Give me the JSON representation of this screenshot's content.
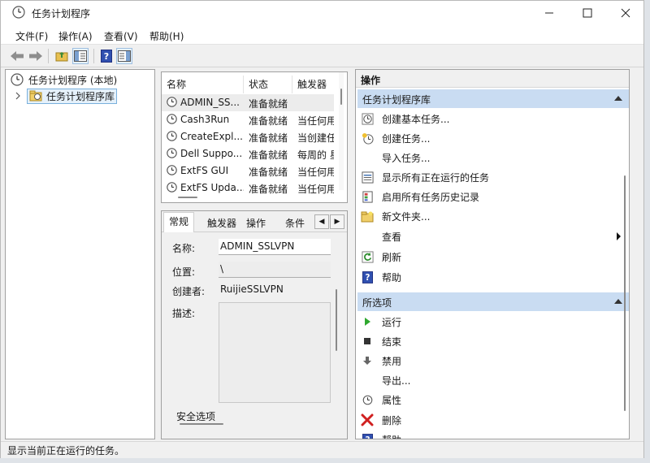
{
  "window": {
    "title": "任务计划程序"
  },
  "menu": [
    "文件(F)",
    "操作(A)",
    "查看(V)",
    "帮助(H)"
  ],
  "tree": {
    "root": "任务计划程序 (本地)",
    "library": "任务计划程序库"
  },
  "task_list": {
    "columns": [
      "名称",
      "状态",
      "触发器"
    ],
    "rows": [
      {
        "name": "ADMIN_SS...",
        "status": "准备就绪",
        "trigger": ""
      },
      {
        "name": "Cash3Run",
        "status": "准备就绪",
        "trigger": "当任何用"
      },
      {
        "name": "CreateExpl...",
        "status": "准备就绪",
        "trigger": "当创建任"
      },
      {
        "name": "Dell Suppo...",
        "status": "准备就绪",
        "trigger": "每周的 星"
      },
      {
        "name": "ExtFS GUI",
        "status": "准备就绪",
        "trigger": "当任何用"
      },
      {
        "name": "ExtFS Upda...",
        "status": "准备就绪",
        "trigger": "当任何用"
      }
    ]
  },
  "detail": {
    "tabs": [
      "常规",
      "触发器",
      "操作",
      "条件"
    ],
    "labels": {
      "name": "名称:",
      "location": "位置:",
      "author": "创建者:",
      "description": "描述:",
      "security": "安全选项"
    },
    "values": {
      "name": "ADMIN_SSLVPN",
      "location": "\\",
      "author": "RuijieSSLVPN"
    }
  },
  "actions": {
    "title": "操作",
    "section1": {
      "header": "任务计划程序库",
      "items": [
        "创建基本任务...",
        "创建任务...",
        "导入任务...",
        "显示所有正在运行的任务",
        "启用所有任务历史记录",
        "新文件夹...",
        "查看",
        "刷新",
        "帮助"
      ]
    },
    "section2": {
      "header": "所选项",
      "items": [
        "运行",
        "结束",
        "禁用",
        "导出...",
        "属性",
        "删除",
        "帮助"
      ]
    }
  },
  "status": "显示当前正在运行的任务。"
}
